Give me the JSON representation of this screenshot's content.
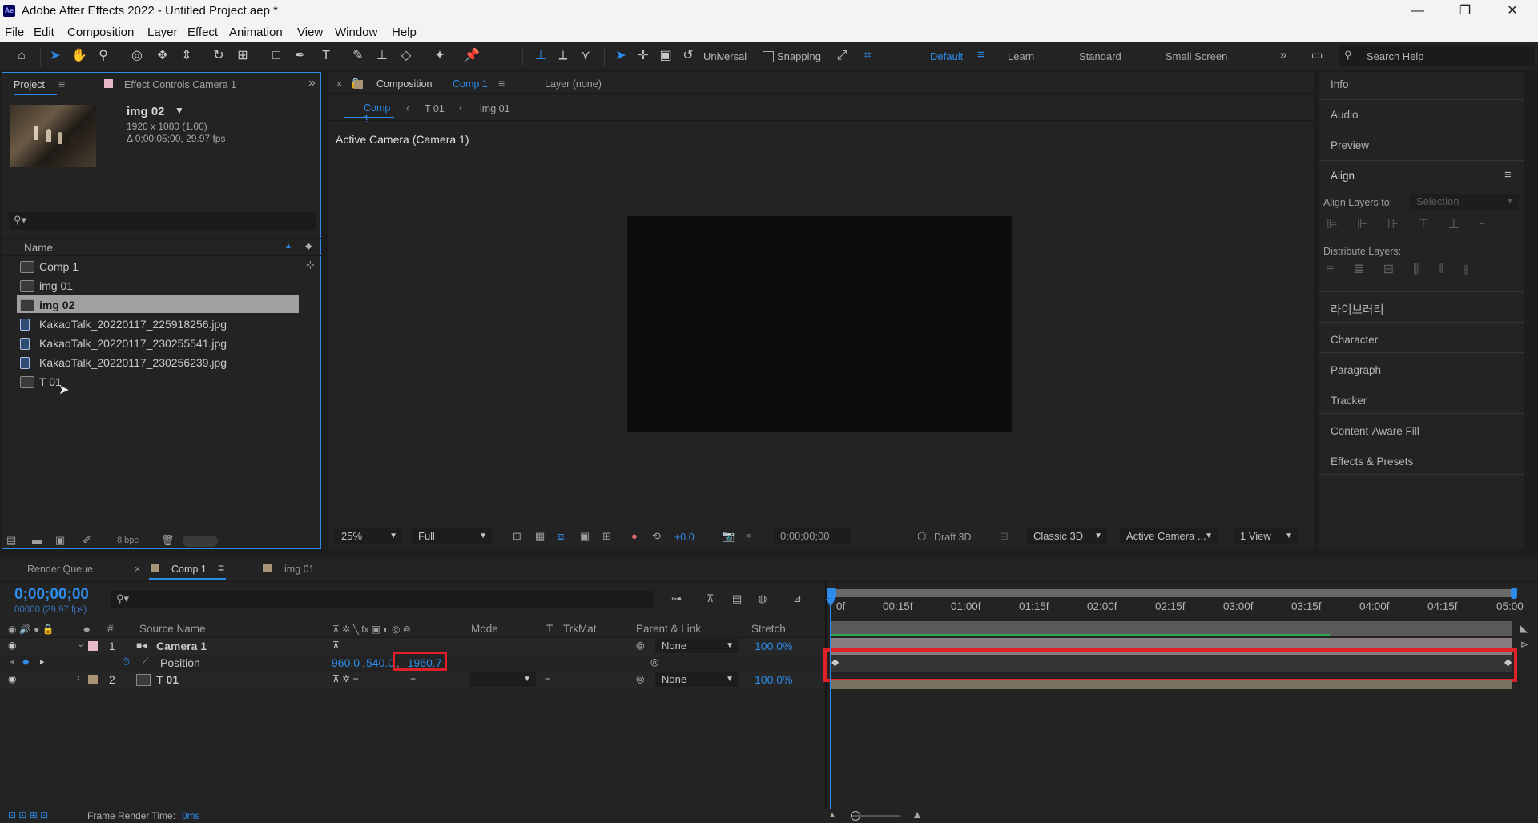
{
  "window": {
    "app_icon": "Ae",
    "title": "Adobe After Effects 2022 - Untitled Project.aep *",
    "controls": {
      "minimize": "—",
      "restore": "❐",
      "close": "✕"
    }
  },
  "menu": [
    "File",
    "Edit",
    "Composition",
    "Layer",
    "Effect",
    "Animation",
    "View",
    "Window",
    "Help"
  ],
  "toolbar": {
    "axis_mode": "Universal",
    "snapping": "Snapping",
    "workspaces": [
      "Default",
      "Learn",
      "Standard",
      "Small Screen"
    ],
    "active_workspace": "Default",
    "search_placeholder": "Search Help"
  },
  "project_panel": {
    "tab_project": "Project",
    "tab_effect_controls": "Effect Controls  Camera 1",
    "preview_name": "img 02",
    "preview_info_1": "1920 x 1080 (1.00)",
    "preview_info_2": "Δ 0;00;05;00, 29.97 fps",
    "search_placeholder": "",
    "column_name": "Name",
    "items": [
      {
        "name": "Comp 1",
        "type": "comp",
        "selected": false
      },
      {
        "name": "img 01",
        "type": "comp",
        "selected": false
      },
      {
        "name": "img 02",
        "type": "comp",
        "selected": true
      },
      {
        "name": "KakaoTalk_20220117_225918256.jpg",
        "type": "image",
        "selected": false
      },
      {
        "name": "KakaoTalk_20220117_230255541.jpg",
        "type": "image",
        "selected": false
      },
      {
        "name": "KakaoTalk_20220117_230256239.jpg",
        "type": "image",
        "selected": false
      },
      {
        "name": "T 01",
        "type": "comp",
        "selected": false
      }
    ],
    "bpc": "8 bpc"
  },
  "composition_panel": {
    "tab_label": "Composition",
    "tab_comp": "Comp 1",
    "layer_tab": "Layer (none)",
    "breadcrumbs": [
      "Comp 1",
      "T 01",
      "img 01"
    ],
    "active_camera_label": "Active Camera (Camera 1)",
    "zoom": "25%",
    "resolution": "Full",
    "exposure": "+0.0",
    "timecode": "0;00;00;00",
    "draft3d": "Draft 3D",
    "renderer": "Classic 3D",
    "camera_view": "Active Camera ...",
    "views": "1 View"
  },
  "right_panel": {
    "items_top": [
      "Info",
      "Audio",
      "Preview"
    ],
    "align_title": "Align",
    "align_layers_to": "Align Layers to:",
    "align_target": "Selection",
    "distribute": "Distribute Layers:",
    "items_bottom": [
      "라이브러리",
      "Character",
      "Paragraph",
      "Tracker",
      "Content-Aware Fill",
      "Effects & Presets"
    ]
  },
  "timeline": {
    "tab_render_queue": "Render Queue",
    "tab_comp": "Comp 1",
    "tab_img": "img 01",
    "current_time": "0;00;00;00",
    "frame_info": "00000 (29.97 fps)",
    "columns": {
      "num": "#",
      "source": "Source Name",
      "mode": "Mode",
      "t": "T",
      "trkmat": "TrkMat",
      "parent": "Parent & Link",
      "stretch": "Stretch"
    },
    "layers": [
      {
        "num": "1",
        "name": "Camera 1",
        "parent": "None",
        "stretch": "100.0%",
        "color": "#e7b9c6"
      },
      {
        "num": "2",
        "name": "T 01",
        "parent": "None",
        "stretch": "100.0%",
        "color": "#a89374",
        "mode": "-"
      }
    ],
    "property": {
      "name": "Position",
      "x": "960.0",
      "y": "540.0",
      "z": "-1960.7"
    },
    "ruler_ticks": [
      "0f",
      "00:15f",
      "01:00f",
      "01:15f",
      "02:00f",
      "02:15f",
      "03:00f",
      "03:15f",
      "04:00f",
      "04:15f",
      "05:00"
    ],
    "frame_render_time_label": "Frame Render Time:",
    "frame_render_time": "0ms"
  },
  "highlight_color": "#e0212a"
}
